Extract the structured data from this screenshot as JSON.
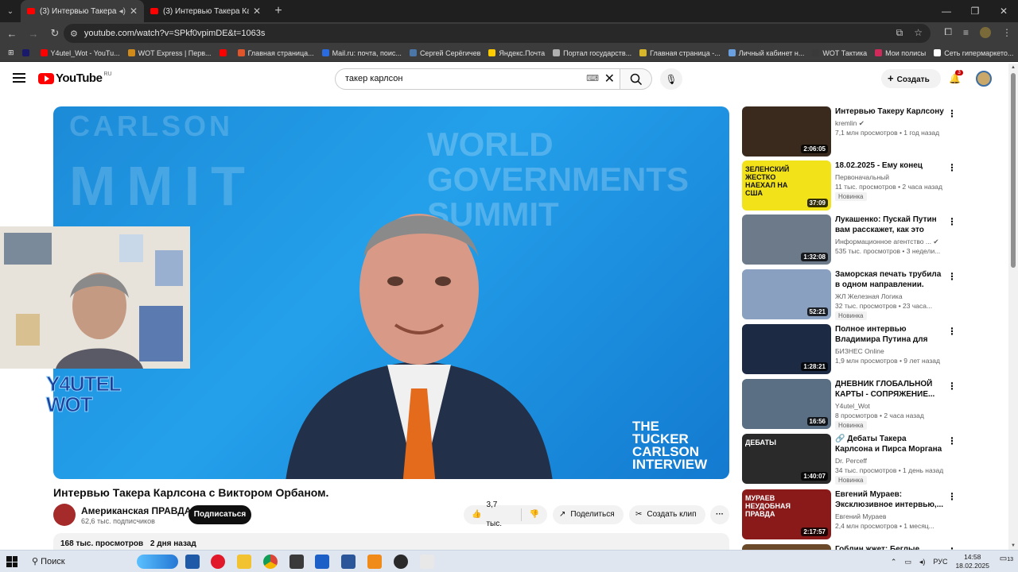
{
  "browser": {
    "tabs": [
      {
        "title": "(3) Интервью Такера Карлсона"
      },
      {
        "title": "(3) Интервью Такера Карлсона"
      }
    ],
    "url": "youtube.com/watch?v=SPkf0vpimDE&t=1063s",
    "bookmarks": [
      {
        "label": "Y4utel_Wot - YouTu...",
        "color": "#ff0000"
      },
      {
        "label": "WOT Express | Перв...",
        "color": "#d08b1b"
      },
      {
        "label": "",
        "color": "#ff0000"
      },
      {
        "label": "Главная страница...",
        "color": "#e0552a"
      },
      {
        "label": "Mail.ru: почта, поис...",
        "color": "#2a6be0"
      },
      {
        "label": "Сергей Серёгичев",
        "color": "#4a76a8"
      },
      {
        "label": "Яндекс.Почта",
        "color": "#ffcc00"
      },
      {
        "label": "Портал государств...",
        "color": "#b0b0b0"
      },
      {
        "label": "Главная страница -...",
        "color": "#d8b62a"
      },
      {
        "label": "Личный кабинет н...",
        "color": "#6aa0e0"
      },
      {
        "label": "WOT Тактика",
        "color": "#3a3a3a"
      },
      {
        "label": "Мои полисы",
        "color": "#d02a5a"
      },
      {
        "label": "Сеть гипермаркето...",
        "color": "#ffffff"
      }
    ]
  },
  "youtube": {
    "logo_text": "YouTube",
    "country": "RU",
    "search_value": "такер карлсон",
    "create_label": "Создать",
    "notif_count": "3"
  },
  "video": {
    "title": "Интервью Такера Карлсона с Виктором Орбаном.",
    "overlay_brand": "THE TUCKER CARLSON INTERVIEW",
    "watermark_left_1": "CARLSON",
    "watermark_left_2": "MMIT",
    "watermark_right": "WORLD GOVERNMENTS SUMMIT",
    "streamer_logo": "Y4UTEL WOT",
    "channel": "Американская ПРАВДА",
    "subscribers": "62,6 тыс. подписчиков",
    "subscribe_label": "Подписаться",
    "likes": "3,7 тыс.",
    "share_label": "Поделиться",
    "clip_label": "Создать клип",
    "views": "168 тыс. просмотров",
    "age": "2 дня назад"
  },
  "recommendations": [
    {
      "title": "Интервью Такеру Карлсону",
      "channel": "kremlin",
      "verified": true,
      "meta": "7,1 млн просмотров • 1 год назад",
      "badge": "",
      "duration": "2:06:05",
      "thumb_bg": "#3a2a1e"
    },
    {
      "title": "18.02.2025 - Ему конец",
      "channel": "Первоначальный",
      "verified": false,
      "meta": "11 тыс. просмотров • 2 часа назад",
      "badge": "Новинка",
      "duration": "37:09",
      "thumb_bg": "#f2e21a",
      "thumb_text": "ЗЕЛЕНСКИЙ ЖЕСТКО НАЕХАЛ НА США"
    },
    {
      "title": "Лукашенко: Пускай Путин вам расскажет, как это было! //...",
      "channel": "Информационное агентство ...",
      "verified": true,
      "meta": "535 тыс. просмотров • 3 недели...",
      "badge": "",
      "duration": "1:32:08",
      "thumb_bg": "#6c7a8a"
    },
    {
      "title": "Заморская печать трубила в одном направлении.",
      "channel": "ЖЛ Железная Логика",
      "verified": false,
      "meta": "32 тыс. просмотров • 23 часа...",
      "badge": "Новинка",
      "duration": "52:21",
      "thumb_bg": "#8aa0c0"
    },
    {
      "title": "Полное интервью Владимира Путина для телеканалов СВ...",
      "channel": "БИЗНЕС Online",
      "verified": false,
      "meta": "1,9 млн просмотров • 9 лет назад",
      "badge": "",
      "duration": "1:28:21",
      "thumb_bg": "#1c2a44"
    },
    {
      "title": "ДНЕВНИК ГЛОБАЛЬНОЙ КАРТЫ - СОПРЯЖЕНИЕ...",
      "channel": "Y4utel_Wot",
      "verified": false,
      "meta": "8 просмотров • 2 часа назад",
      "badge": "Новинка",
      "duration": "16:56",
      "thumb_bg": "#5a6e84"
    },
    {
      "title": "🔗 Дебаты Такера Карлсона и Пирса Моргана | НА РУССКО...",
      "channel": "Dr. Perceff",
      "verified": false,
      "meta": "34 тыс. просмотров • 1 день назад",
      "badge": "Новинка",
      "duration": "1:40:07",
      "thumb_bg": "#2a2a2a",
      "thumb_text": "ДЕБАТЫ"
    },
    {
      "title": "Евгений Мураев: Эксклюзивное интервью,...",
      "channel": "Евгений Мураев",
      "verified": false,
      "meta": "2,4 млн просмотров • 1 месяц...",
      "badge": "",
      "duration": "2:17:57",
      "thumb_bg": "#8a1a1a",
      "thumb_text": "МУРАЕВ НЕУДОБНАЯ ПРАВДА"
    },
    {
      "title": "Гоблин жжет: Беглые звёзды...",
      "channel": "",
      "verified": false,
      "meta": "",
      "badge": "",
      "duration": "",
      "thumb_bg": "#6a4a2a"
    }
  ],
  "taskbar": {
    "search_label": "Поиск",
    "lang": "РУС",
    "time": "14:58",
    "date": "18.02.2025",
    "notif_count": "13"
  }
}
